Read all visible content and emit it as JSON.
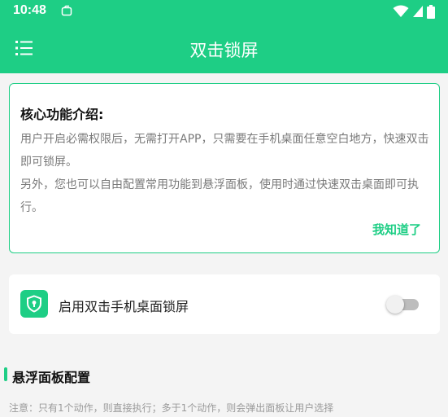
{
  "status_bar": {
    "time": "10:48",
    "notification_icon": "notification-box-icon",
    "icons": [
      "wifi-icon",
      "cellular-icon",
      "battery-icon"
    ]
  },
  "app_bar": {
    "title": "双击锁屏",
    "menu_icon": "list-menu-icon"
  },
  "intro_card": {
    "title": "核心功能介绍:",
    "paragraphs": [
      "用户开启必需权限后，无需打开APP，只需要在手机桌面任意空白地方，快速双击即可锁屏。",
      "另外，您也可以自由配置常用功能到悬浮面板，使用时通过快速双击桌面即可执行。"
    ],
    "ack_label": "我知道了"
  },
  "lock_toggle": {
    "icon": "shield-lock-icon",
    "label": "启用双击手机桌面锁屏",
    "enabled": false
  },
  "float_panel": {
    "title": "悬浮面板配置",
    "note": "注意：只有1个动作，则直接执行；多于1个动作，则会弹出面板让用户选择"
  },
  "colors": {
    "accent": "#1ece85",
    "background": "#f4f4f4",
    "card": "#ffffff",
    "body_text": "#7a7a7a",
    "note_text": "#9a9a9a",
    "switch_off_track": "#bdbdbd"
  }
}
